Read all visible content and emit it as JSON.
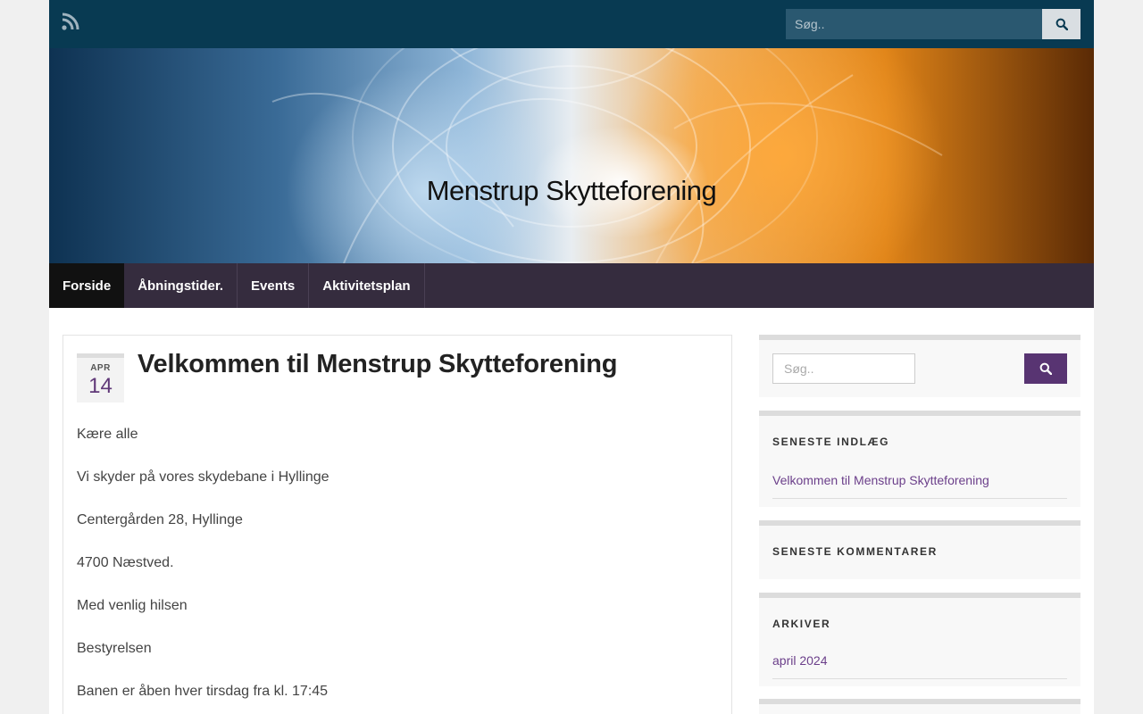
{
  "topbar": {
    "rss_icon": "rss-icon",
    "search_placeholder": "Søg..",
    "search_icon": "search-icon"
  },
  "header": {
    "site_title": "Menstrup Skytteforening"
  },
  "nav": {
    "items": [
      "Forside",
      "Åbningstider.",
      "Events",
      "Aktivitetsplan"
    ],
    "active_index": 0
  },
  "post": {
    "date_month": "APR",
    "date_day": "14",
    "title": "Velkommen til Menstrup Skytteforening",
    "paragraphs": [
      "Kære alle",
      "Vi skyder på vores skydebane i Hyllinge",
      "Centergården 28, Hyllinge",
      "4700 Næstved.",
      "Med venlig hilsen",
      "Bestyrelsen",
      "Banen er åben hver tirsdag fra kl. 17:45"
    ]
  },
  "sidebar": {
    "search_placeholder": "Søg..",
    "recent_posts_title": "SENESTE INDLÆG",
    "recent_posts": [
      "Velkommen til Menstrup Skytteforening"
    ],
    "recent_comments_title": "SENESTE KOMMENTARER",
    "archives_title": "ARKIVER",
    "archives": [
      "april 2024"
    ]
  },
  "colors": {
    "topbar": "#083a52",
    "nav": "#352c3e",
    "accent": "#583472",
    "link": "#6b3f8a"
  }
}
